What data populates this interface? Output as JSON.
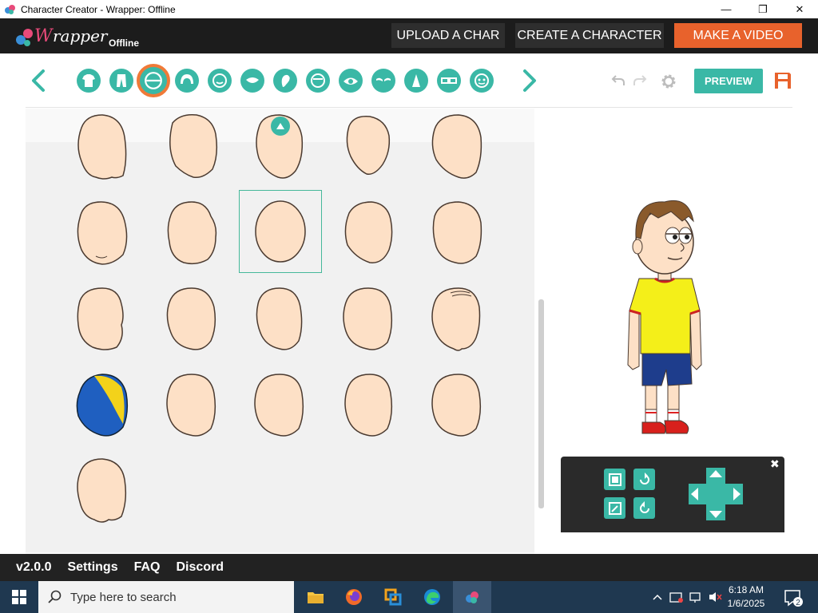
{
  "window": {
    "title": "Character Creator - Wrapper: Offline",
    "controls": [
      "—",
      "❐",
      "✕"
    ]
  },
  "header": {
    "logo_main": "Wrapper",
    "logo_sub": "Offline",
    "buttons": {
      "upload": "UPLOAD A CHAR",
      "create": "CREATE A CHARACTER",
      "video": "MAKE A VIDEO"
    },
    "accent": "#e8622c"
  },
  "toolbar": {
    "categories": [
      "upper-body",
      "lower-body",
      "head-shape",
      "hair",
      "face-shape",
      "mouth",
      "ear",
      "eye-shape",
      "eyes",
      "eyebrows",
      "nose",
      "glasses",
      "accessories"
    ],
    "active_category": "head-shape",
    "preview_label": "PREVIEW",
    "accent": "#3ab8a6"
  },
  "grid": {
    "rows": 5,
    "cols": 5,
    "selected_index": 7,
    "items_count": 21
  },
  "footer": {
    "items": [
      "v2.0.0",
      "Settings",
      "FAQ",
      "Discord"
    ]
  },
  "taskbar": {
    "search_placeholder": "Type here to search",
    "time": "6:18 AM",
    "date": "1/6/2025",
    "notification_count": "2"
  }
}
